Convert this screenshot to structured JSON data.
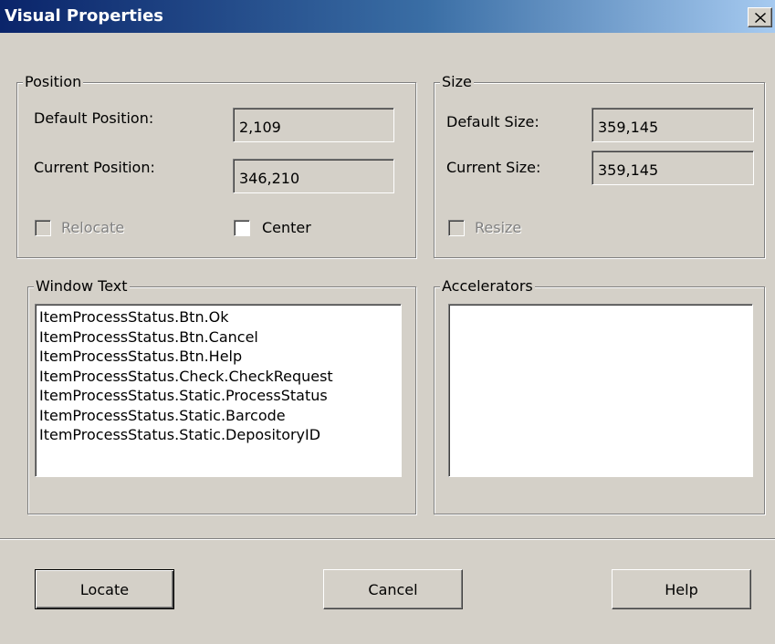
{
  "window": {
    "title": "Visual Properties",
    "close_icon": "close-icon"
  },
  "position_group": {
    "legend": "Position",
    "default_label": "Default Position:",
    "default_value": "2,109",
    "current_label": "Current Position:",
    "current_value": "346,210",
    "relocate_label": "Relocate",
    "relocate_checked": false,
    "relocate_disabled": true,
    "center_label": "Center",
    "center_checked": false
  },
  "size_group": {
    "legend": "Size",
    "default_label": "Default Size:",
    "default_value": "359,145",
    "current_label": "Current Size:",
    "current_value": "359,145",
    "resize_label": "Resize",
    "resize_checked": false,
    "resize_disabled": true
  },
  "window_text_group": {
    "legend": "Window Text",
    "items": [
      "ItemProcessStatus.Btn.Ok",
      "ItemProcessStatus.Btn.Cancel",
      "ItemProcessStatus.Btn.Help",
      "ItemProcessStatus.Check.CheckRequest",
      "ItemProcessStatus.Static.ProcessStatus",
      "ItemProcessStatus.Static.Barcode",
      "ItemProcessStatus.Static.DepositoryID"
    ]
  },
  "accelerators_group": {
    "legend": "Accelerators",
    "items": []
  },
  "buttons": {
    "locate": "Locate",
    "cancel": "Cancel",
    "help": "Help"
  },
  "colors": {
    "title_start": "#0a246a",
    "title_end": "#a6caf0",
    "face": "#d4d0c8"
  }
}
